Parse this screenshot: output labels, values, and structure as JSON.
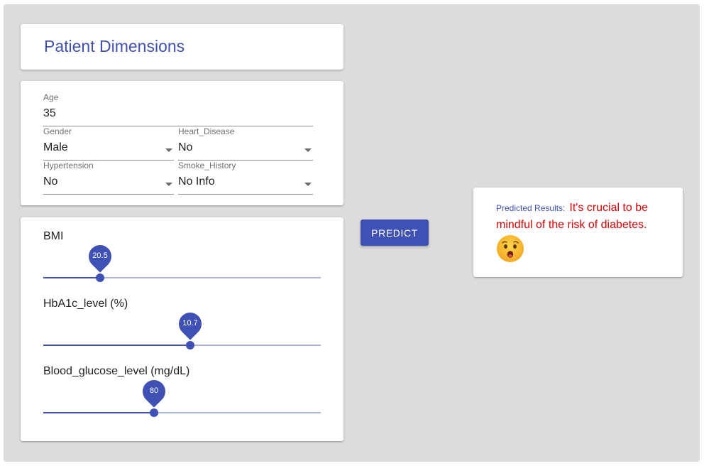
{
  "title": "Patient Dimensions",
  "fields": {
    "age": {
      "label": "Age",
      "value": "35"
    },
    "gender": {
      "label": "Gender",
      "value": "Male"
    },
    "heart_disease": {
      "label": "Heart_Disease",
      "value": "No"
    },
    "hypertension": {
      "label": "Hypertension",
      "value": "No"
    },
    "smoke_history": {
      "label": "Smoke_History",
      "value": "No Info"
    }
  },
  "sliders": {
    "bmi": {
      "label": "BMI",
      "value": "20.5",
      "fraction": 0.205
    },
    "hba1c": {
      "label": "HbA1c_level (%)",
      "value": "10.7",
      "fraction": 0.53
    },
    "glucose": {
      "label": "Blood_glucose_level (mg/dL)",
      "value": "80",
      "fraction": 0.4
    }
  },
  "predict_label": "PREDICT",
  "result": {
    "label": "Predicted Results:",
    "message": "It's crucial to be mindful of the risk of diabetes.",
    "icon": "worried-face-icon"
  },
  "colors": {
    "primary": "#3f51b5",
    "track": "#aab4de",
    "warning": "#e00000",
    "background": "#dcdcdc"
  }
}
